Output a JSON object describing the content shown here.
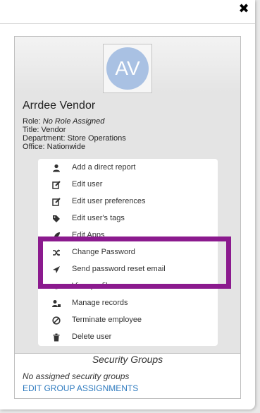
{
  "modal": {
    "close_label": "✖"
  },
  "profile": {
    "avatar_initials": "AV",
    "name": "Arrdee Vendor",
    "role_label": "Role:",
    "role_value": "No Role Assigned",
    "title_label": "Title:",
    "title_value": "Vendor",
    "department_label": "Department:",
    "department_value": "Store Operations",
    "office_label": "Office:",
    "office_value": "Nationwide"
  },
  "menu": {
    "items": [
      {
        "label": "Add a direct report",
        "icon": "user-icon"
      },
      {
        "label": "Edit user",
        "icon": "edit-icon"
      },
      {
        "label": "Edit user preferences",
        "icon": "edit-icon"
      },
      {
        "label": "Edit user's tags",
        "icon": "tags-icon"
      },
      {
        "label": "Edit Apps",
        "icon": "rocket-icon"
      },
      {
        "label": "Change Password",
        "icon": "random-icon"
      },
      {
        "label": "Send password reset email",
        "icon": "send-icon"
      },
      {
        "label": "View profile",
        "icon": "eye-icon"
      },
      {
        "label": "Manage records",
        "icon": "user-lock-icon"
      },
      {
        "label": "Terminate employee",
        "icon": "ban-icon"
      },
      {
        "label": "Delete user",
        "icon": "trash-icon"
      }
    ]
  },
  "security_groups": {
    "title": "Security Groups",
    "empty_text": "No assigned security groups",
    "edit_link": "EDIT GROUP ASSIGNMENTS"
  },
  "colors": {
    "highlight": "#8b1a8e",
    "link": "#2f7bbf",
    "avatar": "#a9c1e3"
  }
}
